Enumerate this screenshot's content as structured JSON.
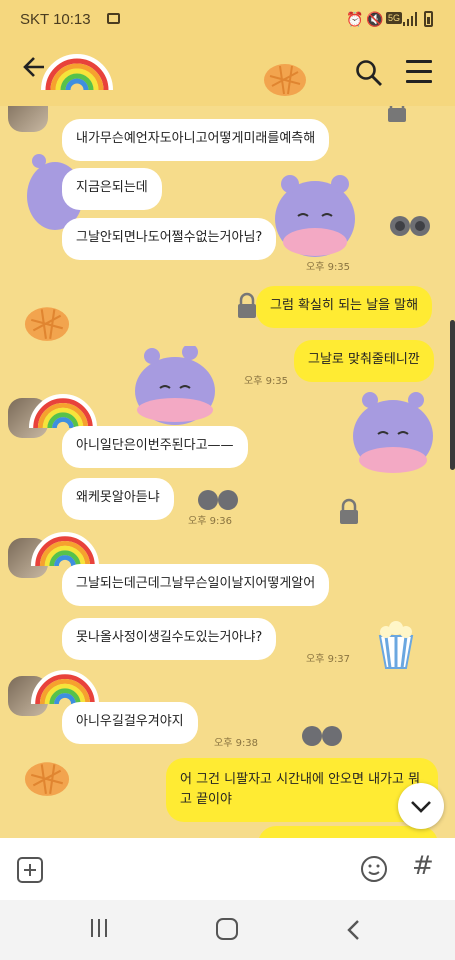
{
  "status_bar": {
    "carrier_time": "SKT 10:13",
    "net_badge": "5G"
  },
  "header": {
    "back_icon": "back-arrow-icon",
    "search_icon": "search-icon",
    "menu_icon": "hamburger-menu-icon"
  },
  "messages": [
    {
      "side": "in",
      "text": "내가무슨예언자도아니고어떻게미래를예측해"
    },
    {
      "side": "in",
      "text": "지금은되는데"
    },
    {
      "side": "in",
      "text": "그날안되면나도어쩔수없는거아님?",
      "time": "오후 9:35"
    },
    {
      "side": "out",
      "text": "그럼 확실히 되는 날을 말해"
    },
    {
      "side": "out",
      "text": "그날로 맞춰줄테니깐",
      "time": "오후 9:35"
    },
    {
      "side": "in",
      "text": "아니일단은이번주된다고——"
    },
    {
      "side": "in",
      "text": "왜케못알아듣냐",
      "time": "오후 9:36"
    },
    {
      "side": "in",
      "text": "그날되는데근데그날무슨일이날지어떻게알어"
    },
    {
      "side": "in",
      "text": "못나올사정이생길수도있는거아냐?",
      "time": "오후 9:37"
    },
    {
      "side": "in",
      "text": "아니우길걸우겨야지",
      "time": "오후 9:38"
    },
    {
      "side": "out",
      "text": "어 그건 니팔자고 시간내에 안오면 내가고 뭐고 끝이야"
    }
  ],
  "input": {
    "placeholder": ""
  }
}
